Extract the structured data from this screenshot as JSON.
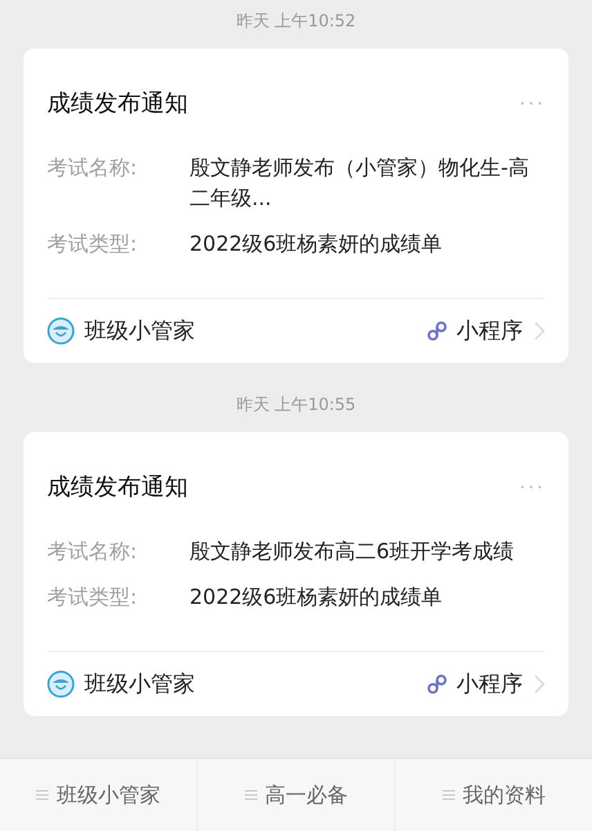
{
  "messages": [
    {
      "time": "昨天 上午10:52",
      "title": "成绩发布通知",
      "more": "···",
      "fields": [
        {
          "label": "考试名称:",
          "value": "殷文静老师发布（小管家）物化生-高二年级..."
        },
        {
          "label": "考试类型:",
          "value": "2022级6班杨素妍的成绩单"
        }
      ],
      "source": "班级小管家",
      "app_label": "小程序"
    },
    {
      "time": "昨天 上午10:55",
      "title": "成绩发布通知",
      "more": "···",
      "fields": [
        {
          "label": "考试名称:",
          "value": "殷文静老师发布高二6班开学考成绩"
        },
        {
          "label": "考试类型:",
          "value": "2022级6班杨素妍的成绩单"
        }
      ],
      "source": "班级小管家",
      "app_label": "小程序"
    }
  ],
  "menu": [
    {
      "label": "班级小管家"
    },
    {
      "label": "高一必备"
    },
    {
      "label": "我的资料"
    }
  ]
}
